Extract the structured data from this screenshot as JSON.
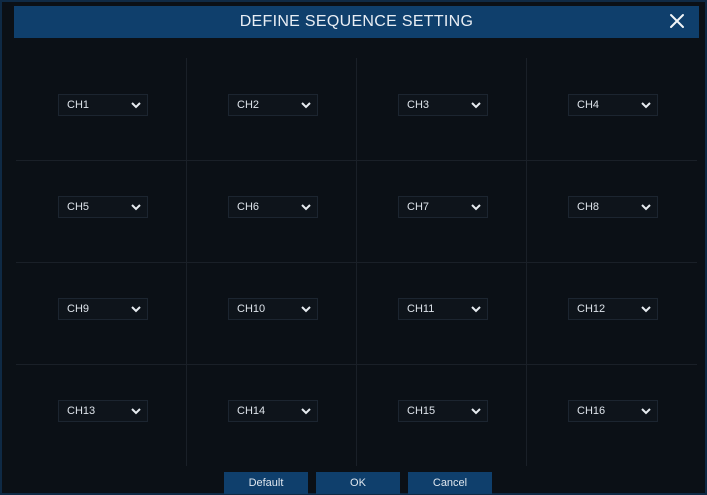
{
  "dialog": {
    "title": "DEFINE SEQUENCE SETTING"
  },
  "icons": {
    "close": "close-icon",
    "dropdown": "chevron-down-icon"
  },
  "colors": {
    "titlebar": "#0f3f6c",
    "button": "#0f3f6c",
    "background": "#0b1016"
  },
  "channels": [
    {
      "label": "CH1"
    },
    {
      "label": "CH2"
    },
    {
      "label": "CH3"
    },
    {
      "label": "CH4"
    },
    {
      "label": "CH5"
    },
    {
      "label": "CH6"
    },
    {
      "label": "CH7"
    },
    {
      "label": "CH8"
    },
    {
      "label": "CH9"
    },
    {
      "label": "CH10"
    },
    {
      "label": "CH11"
    },
    {
      "label": "CH12"
    },
    {
      "label": "CH13"
    },
    {
      "label": "CH14"
    },
    {
      "label": "CH15"
    },
    {
      "label": "CH16"
    }
  ],
  "buttons": {
    "default_label": "Default",
    "ok_label": "OK",
    "cancel_label": "Cancel"
  }
}
